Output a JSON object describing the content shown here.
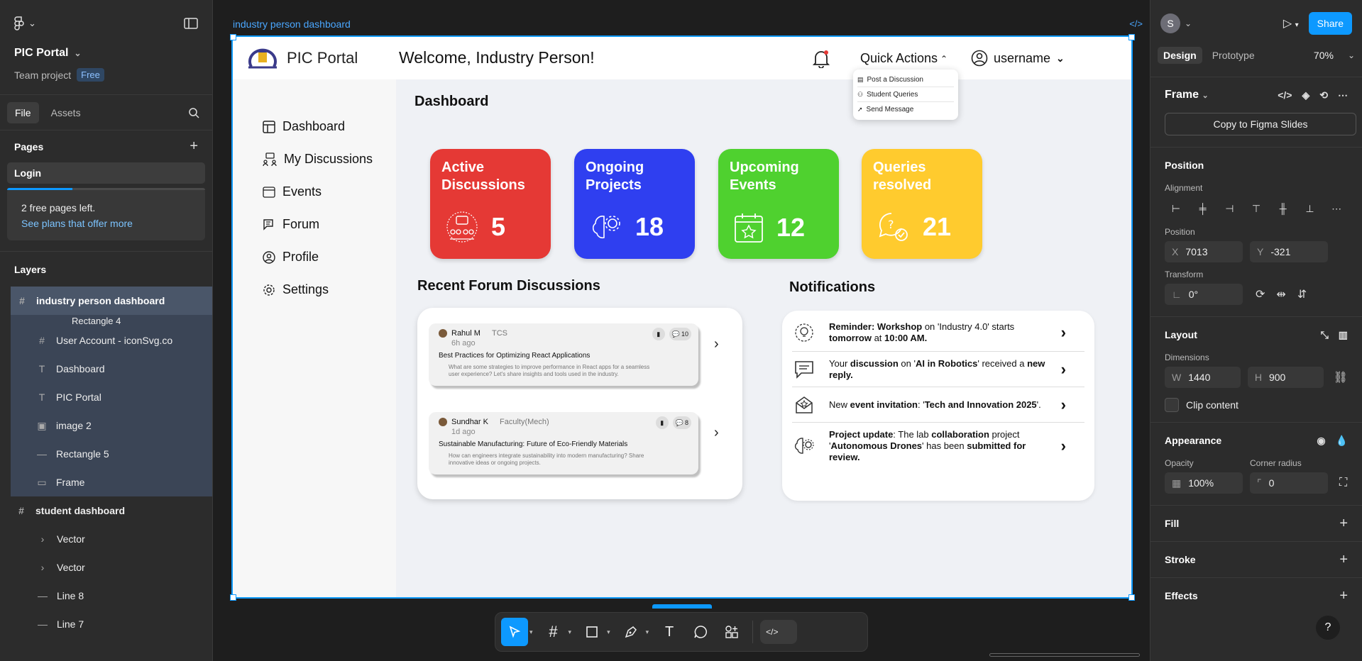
{
  "left_panel": {
    "project_name": "PIC Portal",
    "team": "Team project",
    "plan_badge": "Free",
    "tabs": [
      "File",
      "Assets"
    ],
    "pages_heading": "Pages",
    "current_page": "Login",
    "plan_notice": "2 free pages left.",
    "plan_link": "See plans that offer more",
    "plan_usage_fraction": 0.33,
    "layers_heading": "Layers",
    "layers": [
      {
        "label": "industry person dashboard",
        "icon": "frame-icon"
      },
      {
        "label": "Rectangle 4",
        "icon": "none"
      },
      {
        "label": "User Account - iconSvg.co",
        "icon": "frame-icon"
      },
      {
        "label": "Dashboard",
        "icon": "text-icon"
      },
      {
        "label": "PIC Portal",
        "icon": "text-icon"
      },
      {
        "label": "image 2",
        "icon": "image-icon"
      },
      {
        "label": "Rectangle 5",
        "icon": "line-icon"
      },
      {
        "label": "Frame",
        "icon": "rectangle-icon"
      },
      {
        "label": "student dashboard",
        "icon": "frame-icon"
      },
      {
        "label": "Vector",
        "icon": "vector-icon"
      },
      {
        "label": "Vector",
        "icon": "vector-icon"
      },
      {
        "label": "Line 8",
        "icon": "line-icon"
      },
      {
        "label": "Line 7",
        "icon": "line-icon"
      }
    ]
  },
  "canvas": {
    "frame_label": "industry person dashboard",
    "design": {
      "brand": "PIC Portal",
      "welcome": "Welcome, Industry Person!",
      "quick_actions": "Quick Actions",
      "quick_menu": [
        "Post a Discussion",
        "Student Queries",
        "Send Message"
      ],
      "username": "username",
      "nav": [
        "Dashboard",
        "My Discussions",
        "Events",
        "Forum",
        "Profile",
        "Settings"
      ],
      "dashboard_title": "Dashboard",
      "stats": [
        {
          "title": "Active Discussions",
          "value": "5",
          "color": "#e53935"
        },
        {
          "title": "Ongoing Projects",
          "value": "18",
          "color": "#2f3ff0"
        },
        {
          "title": "Upcoming Events",
          "value": "12",
          "color": "#4fd12f"
        },
        {
          "title": "Queries resolved",
          "value": "21",
          "color": "#ffcb2e"
        }
      ],
      "forum_title": "Recent Forum Discussions",
      "forum_posts": [
        {
          "author": "Rahul M",
          "role": "TCS",
          "time": "6h ago",
          "title": "Best Practices for Optimizing React Applications",
          "body": "What are some strategies to improve performance in React apps for a seamless user experience? Let's share insights and tools used in the industry.",
          "comments": "10"
        },
        {
          "author": "Sundhar K",
          "role": "Faculty(Mech)",
          "time": "1d ago",
          "title": "Sustainable Manufacturing: Future of Eco-Friendly Materials",
          "body": "How can engineers integrate sustainability into modern manufacturing? Share innovative ideas or ongoing projects.",
          "comments": "8"
        }
      ],
      "notifications_title": "Notifications",
      "notifications": [
        {
          "icon": "gear-bulb-icon",
          "parts": [
            [
              "b",
              "Reminder: Workshop"
            ],
            [
              "n",
              " on 'Industry 4.0' starts "
            ],
            [
              "b",
              "tomorrow"
            ],
            [
              "n",
              " at "
            ],
            [
              "b",
              "10:00 AM."
            ]
          ]
        },
        {
          "icon": "chat-icon",
          "parts": [
            [
              "n",
              "Your "
            ],
            [
              "b",
              "discussion"
            ],
            [
              "n",
              " on '"
            ],
            [
              "b",
              "AI in Robotics"
            ],
            [
              "n",
              "' received a "
            ],
            [
              "b",
              "new reply."
            ]
          ]
        },
        {
          "icon": "invitation-icon",
          "parts": [
            [
              "n",
              "New "
            ],
            [
              "b",
              "event invitation"
            ],
            [
              "n",
              ": '"
            ],
            [
              "b",
              "Tech and Innovation 2025"
            ],
            [
              "n",
              "'."
            ]
          ]
        },
        {
          "icon": "brain-gear-icon",
          "parts": [
            [
              "b",
              "Project update"
            ],
            [
              "n",
              ": The lab "
            ],
            [
              "b",
              "collaboration"
            ],
            [
              "n",
              " project '"
            ],
            [
              "b",
              "Autonomous Drones"
            ],
            [
              "n",
              "' has been "
            ],
            [
              "b",
              "submitted"
            ],
            [
              "n",
              " "
            ],
            [
              "b",
              "for review."
            ]
          ]
        }
      ]
    }
  },
  "right_panel": {
    "avatar_letter": "S",
    "share": "Share",
    "tabs": [
      "Design",
      "Prototype"
    ],
    "zoom": "70%",
    "frame_heading": "Frame",
    "copy_button": "Copy to Figma Slides",
    "position_heading": "Position",
    "alignment_label": "Alignment",
    "position_label": "Position",
    "x_label": "X",
    "x": "7013",
    "y_label": "Y",
    "y": "-321",
    "transform_label": "Transform",
    "rotation": "0°",
    "layout_heading": "Layout",
    "dimensions_label": "Dimensions",
    "w_label": "W",
    "w": "1440",
    "h_label": "H",
    "h": "900",
    "clip_content": "Clip content",
    "appearance_heading": "Appearance",
    "opacity_label": "Opacity",
    "opacity": "100%",
    "radius_label": "Corner radius",
    "radius": "0",
    "fill_heading": "Fill",
    "stroke_heading": "Stroke",
    "effects_heading": "Effects",
    "help": "?"
  }
}
